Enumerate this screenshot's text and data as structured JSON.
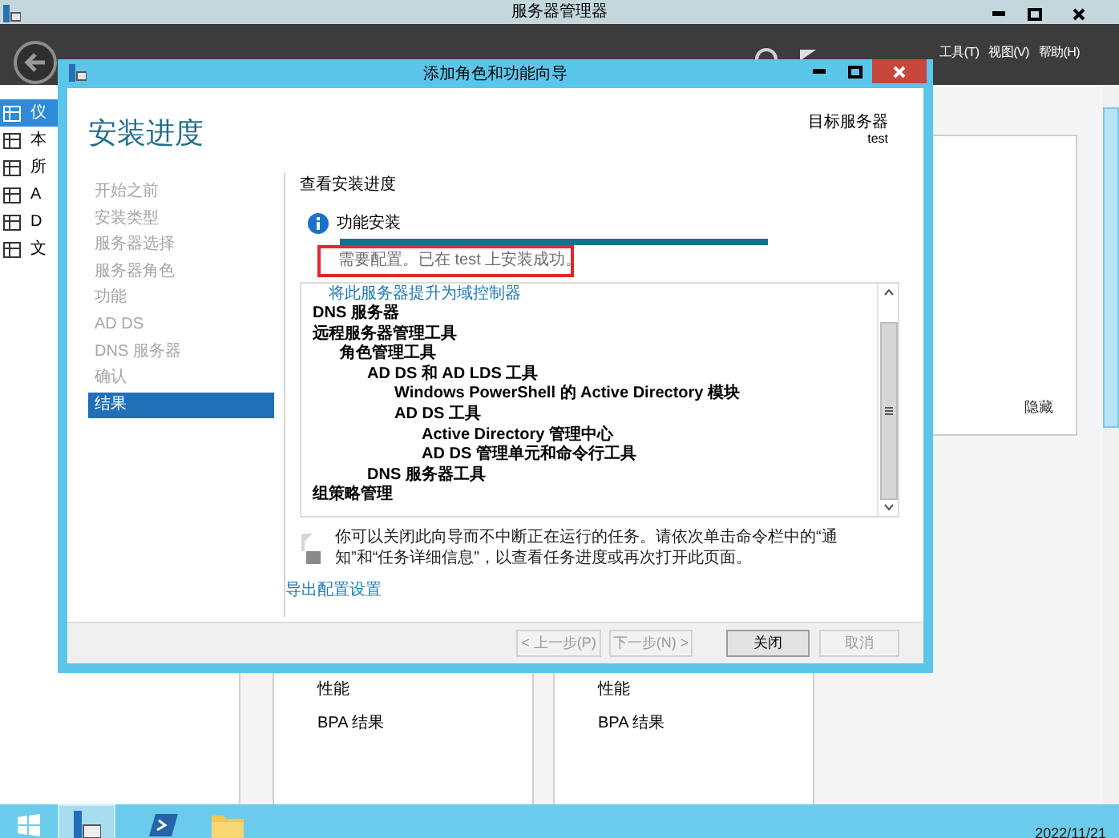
{
  "app": {
    "title": "服务器管理器",
    "menu": [
      "工具(T)",
      "视图(V)",
      "帮助(H)"
    ],
    "sidebar": [
      {
        "label": "仪",
        "selected": true
      },
      {
        "label": "本",
        "selected": false
      },
      {
        "label": "所",
        "selected": false
      },
      {
        "label": "A",
        "selected": false
      },
      {
        "label": "D",
        "selected": false
      },
      {
        "label": "文",
        "selected": false
      }
    ],
    "hide_label": "隐藏",
    "tiles": [
      {
        "items": [
          "性能",
          "BPA 结果"
        ]
      },
      {
        "items": [
          "性能",
          "BPA 结果"
        ]
      }
    ]
  },
  "dialog": {
    "title": "添加角色和功能向导",
    "heading": "安装进度",
    "target_label": "目标服务器",
    "target_name": "test",
    "steps": [
      {
        "label": "开始之前",
        "selected": false
      },
      {
        "label": "安装类型",
        "selected": false
      },
      {
        "label": "服务器选择",
        "selected": false
      },
      {
        "label": "服务器角色",
        "selected": false
      },
      {
        "label": "功能",
        "selected": false
      },
      {
        "label": "AD DS",
        "selected": false
      },
      {
        "label": "DNS 服务器",
        "selected": false
      },
      {
        "label": "确认",
        "selected": false
      },
      {
        "label": "结果",
        "selected": true
      }
    ],
    "section_title": "查看安装进度",
    "feature_title": "功能安装",
    "progress": {
      "level": 1
    },
    "status": "需要配置。已在 test 上安装成功。",
    "link": "将此服务器提升为域控制器",
    "tree": [
      {
        "label": "DNS 服务器"
      },
      {
        "label": "远程服务器管理工具",
        "children": [
          {
            "label": "角色管理工具",
            "children": [
              {
                "label": "AD DS 和 AD LDS 工具",
                "children": [
                  {
                    "label": "Windows PowerShell 的 Active Directory 模块"
                  },
                  {
                    "label": "AD DS 工具",
                    "children": [
                      {
                        "label": "Active Directory 管理中心"
                      },
                      {
                        "label": "AD DS 管理单元和命令行工具"
                      }
                    ]
                  }
                ]
              },
              {
                "label": "DNS 服务器工具"
              }
            ]
          }
        ]
      },
      {
        "label": "组策略管理"
      }
    ],
    "note": "你可以关闭此向导而不中断正在运行的任务。请依次单击命令栏中的“通知”和“任务详细信息”，以查看任务进度或再次打开此页面。",
    "export_link": "导出配置设置",
    "buttons": [
      {
        "label": "< 上一步(P)",
        "disabled": true
      },
      {
        "label": "下一步(N) >",
        "disabled": true
      },
      {
        "label": "关闭",
        "disabled": false
      },
      {
        "label": "取消",
        "disabled": true
      }
    ]
  },
  "taskbar": {
    "date": "2022/11/21"
  }
}
